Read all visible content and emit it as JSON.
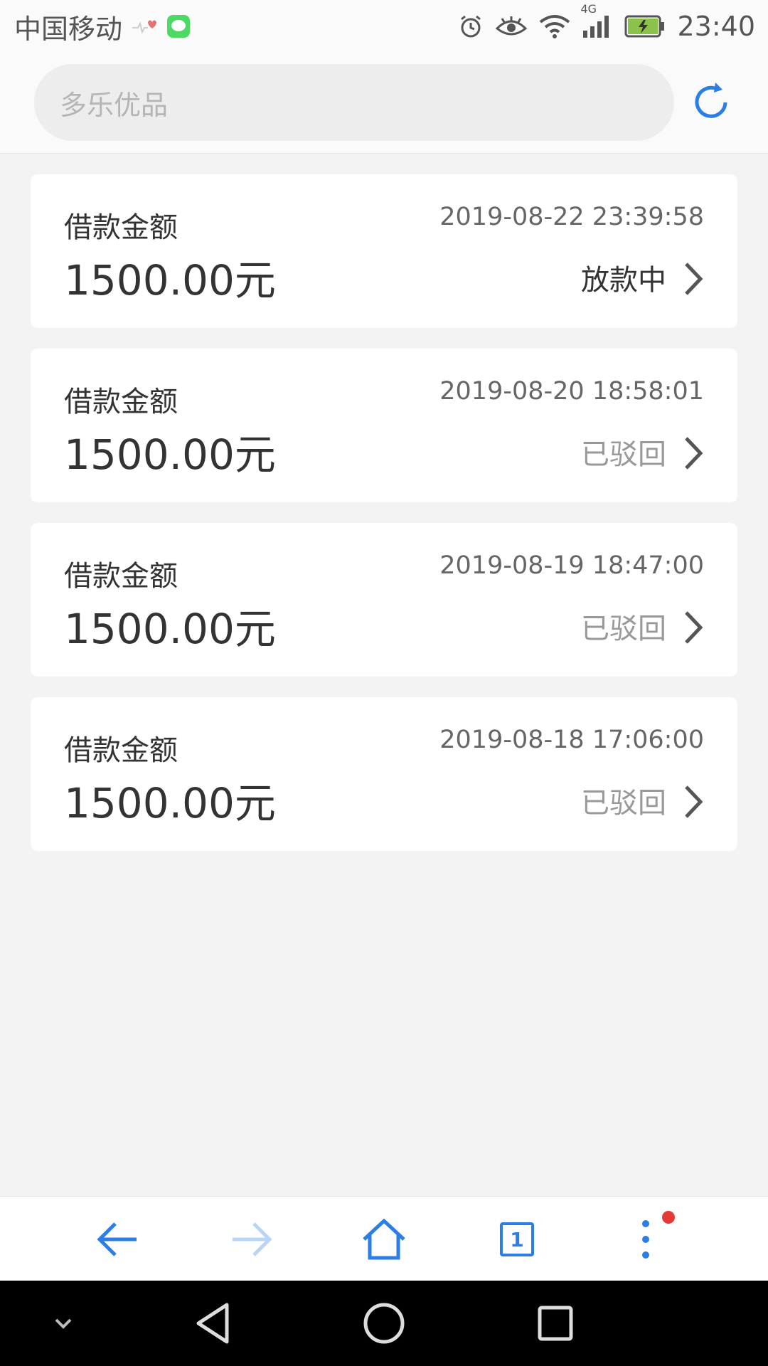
{
  "status_bar": {
    "carrier": "中国移动",
    "network": "4G",
    "time": "23:40",
    "icons": [
      "heartbeat-icon",
      "message-icon",
      "alarm-icon",
      "eye-icon",
      "wifi-icon",
      "signal-icon",
      "battery-icon"
    ]
  },
  "header": {
    "search_placeholder": "多乐优品",
    "refresh_icon": "refresh-icon",
    "accent_color": "#2a7ee6"
  },
  "loans": [
    {
      "label": "借款金额",
      "amount": "1500.00元",
      "date": "2019-08-22 23:39:58",
      "status": "放款中",
      "status_color": "#333333"
    },
    {
      "label": "借款金额",
      "amount": "1500.00元",
      "date": "2019-08-20 18:58:01",
      "status": "已驳回",
      "status_color": "#999999"
    },
    {
      "label": "借款金额",
      "amount": "1500.00元",
      "date": "2019-08-19 18:47:00",
      "status": "已驳回",
      "status_color": "#999999"
    },
    {
      "label": "借款金额",
      "amount": "1500.00元",
      "date": "2019-08-18 17:06:00",
      "status": "已驳回",
      "status_color": "#999999"
    }
  ],
  "toolbar": {
    "icons": [
      "back-arrow-icon",
      "forward-arrow-icon",
      "home-icon",
      "tabs-icon",
      "more-menu-icon"
    ],
    "tab_count": "1",
    "notification_dot_color": "#e53935"
  },
  "nav_bar": {
    "icons": [
      "collapse-icon",
      "back-triangle-icon",
      "home-circle-icon",
      "recents-square-icon"
    ]
  }
}
